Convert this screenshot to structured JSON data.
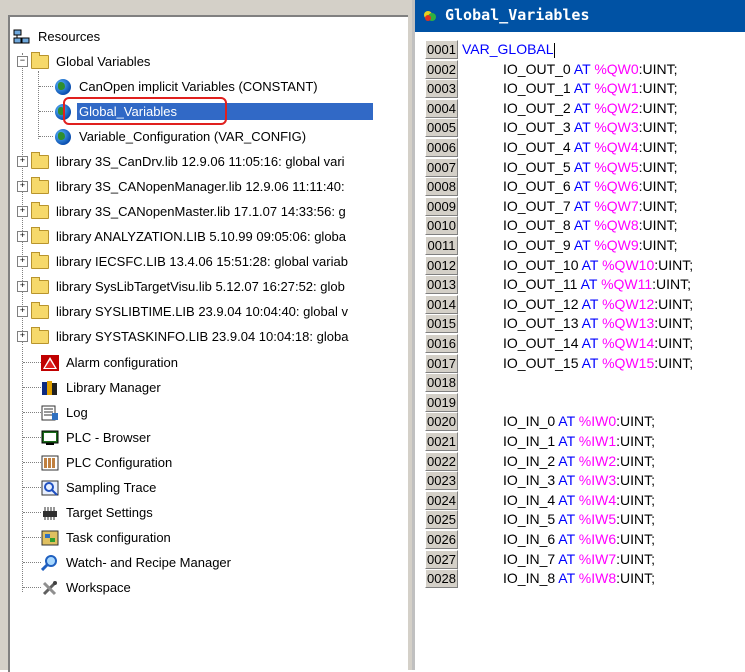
{
  "tree": {
    "root": "Resources",
    "global_variables": "Global Variables",
    "gv_children": [
      "CanOpen implicit Variables (CONSTANT)",
      "Global_Variables",
      "Variable_Configuration (VAR_CONFIG)"
    ],
    "libraries": [
      "library 3S_CanDrv.lib 12.9.06 11:05:16: global vari",
      "library 3S_CANopenManager.lib 12.9.06 11:11:40:",
      "library 3S_CANopenMaster.lib 17.1.07 14:33:56: g",
      "library ANALYZATION.LIB 5.10.99 09:05:06: globa",
      "library IECSFC.LIB 13.4.06 15:51:28: global variab",
      "library SysLibTargetVisu.lib 5.12.07 16:27:52: glob",
      "library SYSLIBTIME.LIB 23.9.04 10:04:40: global v",
      "library SYSTASKINFO.LIB 23.9.04 10:04:18: globa"
    ],
    "resources": [
      "Alarm configuration",
      "Library Manager",
      "Log",
      "PLC - Browser",
      "PLC Configuration",
      "Sampling Trace",
      "Target Settings",
      "Task configuration",
      "Watch- and Recipe Manager",
      "Workspace"
    ]
  },
  "editor": {
    "title": "Global_Variables",
    "line_numbers": [
      "0001",
      "0002",
      "0003",
      "0004",
      "0005",
      "0006",
      "0007",
      "0008",
      "0009",
      "0010",
      "0011",
      "0012",
      "0013",
      "0014",
      "0015",
      "0016",
      "0017",
      "0018",
      "0019",
      "0020",
      "0021",
      "0022",
      "0023",
      "0024",
      "0025",
      "0026",
      "0027",
      "0028"
    ],
    "header": "VAR_GLOBAL",
    "at": "AT",
    "lines": [
      {
        "name": "IO_OUT_0",
        "addr": "%QW0",
        "type": ":UINT;"
      },
      {
        "name": "IO_OUT_1",
        "addr": "%QW1",
        "type": ":UINT;"
      },
      {
        "name": "IO_OUT_2",
        "addr": "%QW2",
        "type": ":UINT;"
      },
      {
        "name": "IO_OUT_3",
        "addr": "%QW3",
        "type": ":UINT;"
      },
      {
        "name": "IO_OUT_4",
        "addr": "%QW4",
        "type": ":UINT;"
      },
      {
        "name": "IO_OUT_5",
        "addr": "%QW5",
        "type": ":UINT;"
      },
      {
        "name": "IO_OUT_6",
        "addr": "%QW6",
        "type": ":UINT;"
      },
      {
        "name": "IO_OUT_7",
        "addr": "%QW7",
        "type": ":UINT;"
      },
      {
        "name": "IO_OUT_8",
        "addr": "%QW8",
        "type": ":UINT;"
      },
      {
        "name": "IO_OUT_9",
        "addr": "%QW9",
        "type": ":UINT;"
      },
      {
        "name": "IO_OUT_10",
        "addr": "%QW10",
        "type": ":UINT;"
      },
      {
        "name": "IO_OUT_11",
        "addr": "%QW11",
        "type": ":UINT;"
      },
      {
        "name": "IO_OUT_12",
        "addr": "%QW12",
        "type": ":UINT;"
      },
      {
        "name": "IO_OUT_13",
        "addr": "%QW13",
        "type": ":UINT;"
      },
      {
        "name": "IO_OUT_14",
        "addr": "%QW14",
        "type": ":UINT;"
      },
      {
        "name": "IO_OUT_15",
        "addr": "%QW15",
        "type": ":UINT;"
      },
      null,
      null,
      {
        "name": "IO_IN_0",
        "addr": "%IW0",
        "type": ":UINT;"
      },
      {
        "name": "IO_IN_1",
        "addr": "%IW1",
        "type": ":UINT;"
      },
      {
        "name": "IO_IN_2",
        "addr": "%IW2",
        "type": ":UINT;"
      },
      {
        "name": "IO_IN_3",
        "addr": "%IW3",
        "type": ":UINT;"
      },
      {
        "name": "IO_IN_4",
        "addr": "%IW4",
        "type": ":UINT;"
      },
      {
        "name": "IO_IN_5",
        "addr": "%IW5",
        "type": ":UINT;"
      },
      {
        "name": "IO_IN_6",
        "addr": "%IW6",
        "type": ":UINT;"
      },
      {
        "name": "IO_IN_7",
        "addr": "%IW7",
        "type": ":UINT;"
      },
      {
        "name": "IO_IN_8",
        "addr": "%IW8",
        "type": ":UINT;"
      }
    ]
  },
  "colors": {
    "title_bar": "#0052a4",
    "selection": "#3169c6",
    "keyword": "#0000ff",
    "address": "#ff00ff",
    "highlight_box": "#e0201e"
  }
}
